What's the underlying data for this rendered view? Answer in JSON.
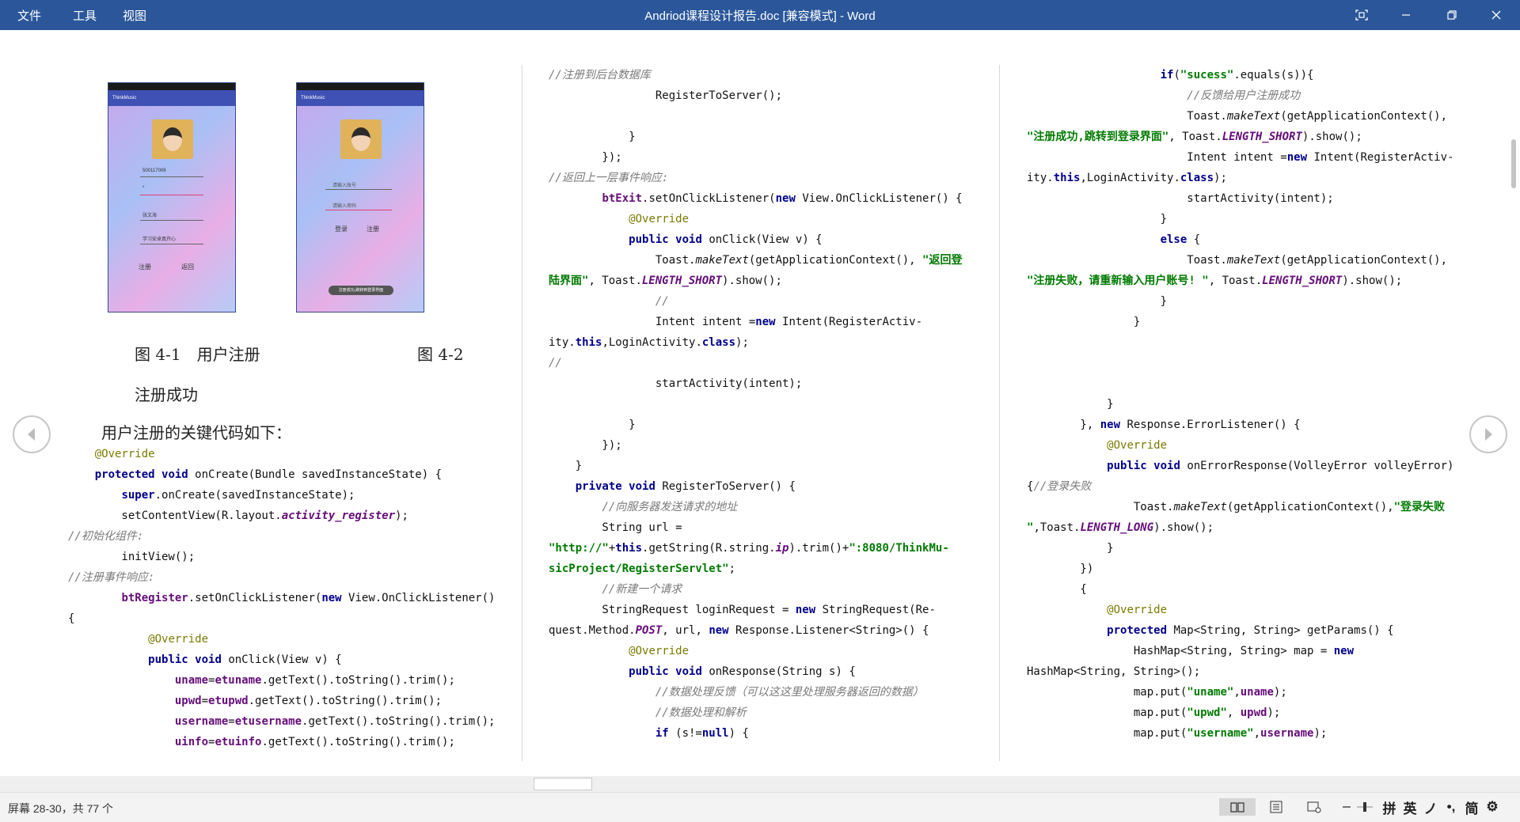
{
  "titlebar": {
    "menus": [
      "文件",
      "工具",
      "视图"
    ],
    "doc_title": "Andriod课程设计报告.doc [兼容模式]  -  Word"
  },
  "figure": {
    "app_name": "ThinkMusic",
    "phone1": {
      "fields": [
        "500117008",
        "*",
        "张文海",
        "学习安卓真开心"
      ],
      "buttons": [
        "注册",
        "返回"
      ]
    },
    "phone2": {
      "fields": [
        "请输入账号",
        "请输入密码"
      ],
      "buttons": [
        "登录",
        "注册"
      ],
      "toast": "注册成功,跳转到登录界面"
    },
    "caption1": "图 4-1　用户注册",
    "caption2": "图 4-2",
    "caption2b": "注册成功",
    "intro": "用户注册的关键代码如下："
  },
  "status": {
    "page_info": "屏幕 28-30，共 77 个",
    "ime": [
      "拼",
      "英",
      "ノ",
      "•,",
      "简",
      "⚙"
    ]
  },
  "colors": {
    "titlebar": "#2b579a",
    "keyword": "#00008b",
    "string": "#007a00",
    "comment": "#7a7a7a",
    "annotation": "#7a7a00",
    "field": "#660e7a"
  }
}
